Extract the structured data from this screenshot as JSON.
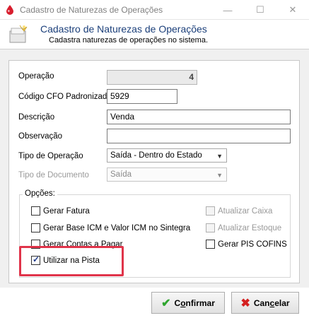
{
  "window": {
    "title": "Cadastro de Naturezas de Operações",
    "minimize_glyph": "—",
    "maximize_glyph": "☐",
    "close_glyph": "✕"
  },
  "header": {
    "title": "Cadastro de Naturezas de Operações",
    "subtitle": "Cadastra naturezas de operações no sistema."
  },
  "form": {
    "operacao": {
      "label": "Operação",
      "value": "4"
    },
    "cfo": {
      "label": "Código CFO Padronizado",
      "value": "5929"
    },
    "descricao": {
      "label": "Descrição",
      "value": "Venda"
    },
    "observacao": {
      "label": "Observação",
      "value": ""
    },
    "tipo_operacao": {
      "label": "Tipo de Operação",
      "value": "Saída - Dentro do Estado"
    },
    "tipo_documento": {
      "label": "Tipo de Documento",
      "value": "Saída"
    }
  },
  "options": {
    "legend": "Opções:",
    "gerar_fatura": {
      "label": "Gerar Fatura",
      "checked": false,
      "enabled": true
    },
    "gerar_base_icm": {
      "label": "Gerar Base ICM e Valor ICM no Sintegra",
      "checked": false,
      "enabled": true
    },
    "gerar_contas_pagar": {
      "label": "Gerar Contas a Pagar",
      "checked": false,
      "enabled": true
    },
    "utilizar_pista": {
      "label": "Utilizar na Pista",
      "checked": true,
      "enabled": true
    },
    "atualizar_caixa": {
      "label": "Atualizar Caixa",
      "checked": false,
      "enabled": false
    },
    "atualizar_estoque": {
      "label": "Atualizar Estoque",
      "checked": false,
      "enabled": false
    },
    "gerar_pis_cofins": {
      "label": "Gerar PIS COFINS",
      "checked": false,
      "enabled": true
    }
  },
  "buttons": {
    "confirm_prefix": "C",
    "confirm_underline": "o",
    "confirm_rest": "nfirmar",
    "cancel_prefix": "Can",
    "cancel_underline": "c",
    "cancel_rest": "elar"
  },
  "colors": {
    "header_title": "#1b3f7a",
    "highlight": "#e0344a",
    "confirm_icon": "#2ea52e",
    "cancel_icon": "#d42020"
  }
}
